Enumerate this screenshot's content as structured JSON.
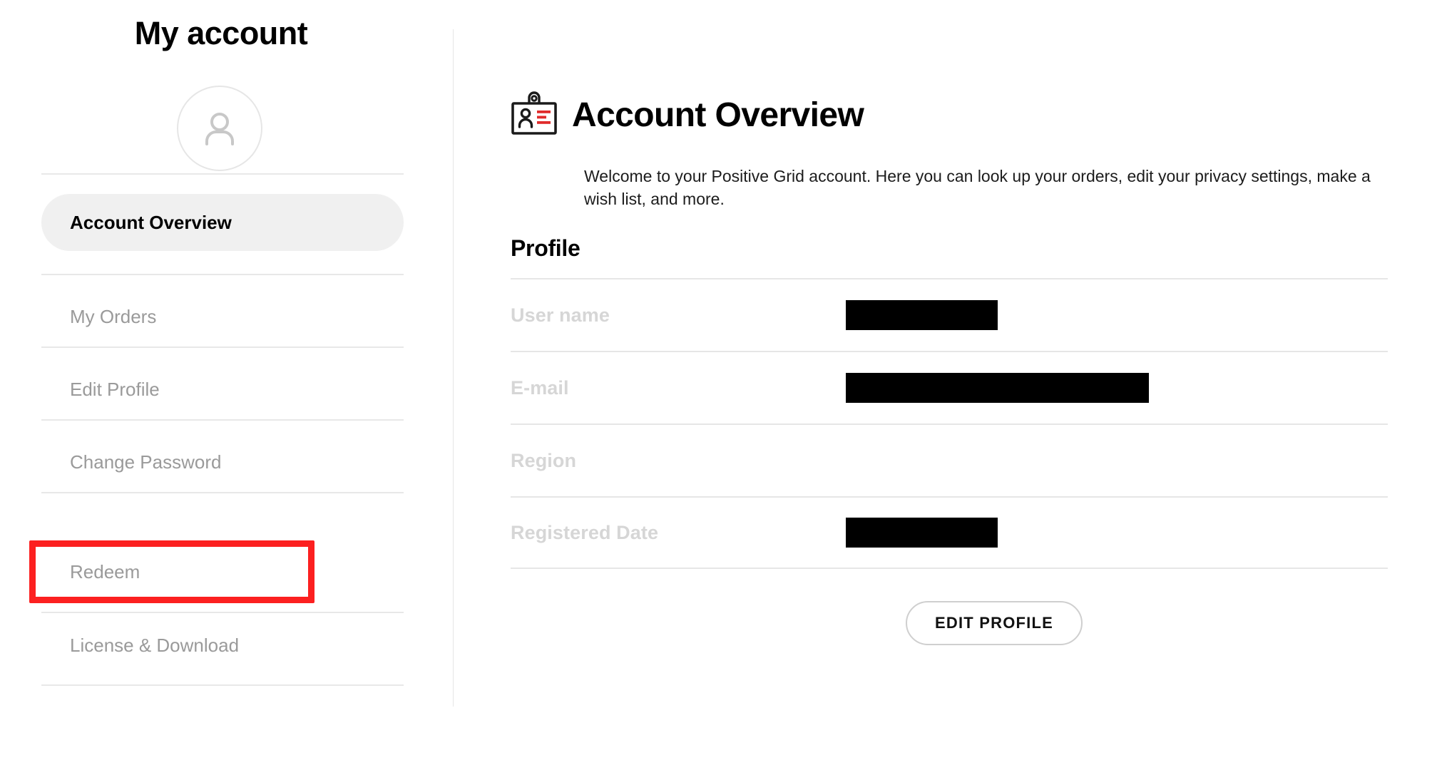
{
  "sidebar": {
    "title": "My account",
    "avatar_icon": "person-avatar-icon",
    "items": [
      {
        "label": "Account Overview",
        "active": true
      },
      {
        "label": "My Orders",
        "active": false
      },
      {
        "label": "Edit Profile",
        "active": false
      },
      {
        "label": "Change Password",
        "active": false
      },
      {
        "label": "Redeem",
        "active": false,
        "highlighted": true
      },
      {
        "label": "License & Download",
        "active": false
      }
    ]
  },
  "annotation": {
    "target": "Redeem",
    "color": "#fc2020"
  },
  "main": {
    "header_icon": "id-badge-icon",
    "title": "Account Overview",
    "description": "Welcome to your Positive Grid account. Here you can look up your orders, edit your privacy settings, make a wish list, and more.",
    "profile": {
      "heading": "Profile",
      "rows": [
        {
          "label": "User name",
          "value": "",
          "redacted": true,
          "redaction_width": 213
        },
        {
          "label": "E-mail",
          "value": "",
          "redacted": true,
          "redaction_width": 425
        },
        {
          "label": "Region",
          "value": "",
          "redacted": false,
          "redaction_width": 0
        },
        {
          "label": "Registered Date",
          "value": "",
          "redacted": true,
          "redaction_width": 213
        }
      ],
      "edit_button_label": "EDIT PROFILE"
    }
  },
  "colors": {
    "accent_red": "#e02b2b",
    "annotation_red": "#fc2020",
    "active_pill": "#f0f0f0",
    "muted_text": "#9a9a9a",
    "label_text": "#d6d6d6",
    "divider": "#e6e6e6"
  }
}
